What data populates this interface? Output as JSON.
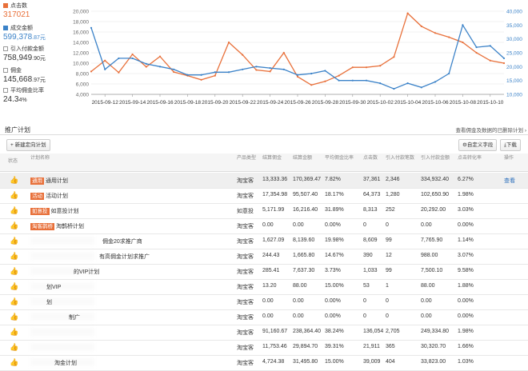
{
  "metrics": [
    {
      "label": "点击数",
      "value": "317021",
      "value_small": "",
      "checked": true,
      "color": "#e8703a"
    },
    {
      "label": "成交金额",
      "value": "599,378",
      "value_small": ".87元",
      "checked": true,
      "color": "#3b82c8"
    },
    {
      "label": "引入付款金额",
      "value": "758,949",
      "value_small": ".90元",
      "checked": false,
      "color": "#333333"
    },
    {
      "label": "佣金",
      "value": "145,668",
      "value_small": ".97元",
      "checked": false,
      "color": "#333333"
    },
    {
      "label": "平均佣金比率",
      "value": "24.3",
      "value_small": "4%",
      "checked": false,
      "color": "#333333"
    }
  ],
  "chart_data": {
    "type": "line",
    "x": [
      "2015-09-11",
      "2015-09-12",
      "2015-09-13",
      "2015-09-14",
      "2015-09-15",
      "2015-09-16",
      "2015-09-17",
      "2015-09-18",
      "2015-09-19",
      "2015-09-20",
      "2015-09-21",
      "2015-09-22",
      "2015-09-23",
      "2015-09-24",
      "2015-09-25",
      "2015-09-26",
      "2015-09-27",
      "2015-09-28",
      "2015-09-29",
      "2015-09-30",
      "2015-10-01",
      "2015-10-02",
      "2015-10-03",
      "2015-10-04",
      "2015-10-05",
      "2015-10-06",
      "2015-10-07",
      "2015-10-08",
      "2015-10-09",
      "2015-10-10",
      "2015-10-11"
    ],
    "xticks": [
      "2015-09-12",
      "2015-09-14",
      "2015-09-16",
      "2015-09-18",
      "2015-09-20",
      "2015-09-22",
      "2015-09-24",
      "2015-09-26",
      "2015-09-28",
      "2015-09-30",
      "2015-10-02",
      "2015-10-04",
      "2015-10-06",
      "2015-10-08",
      "2015-10-10"
    ],
    "yleft": {
      "min": 4000,
      "max": 20000,
      "ticks": [
        "4,000",
        "6,000",
        "8,000",
        "10,000",
        "12,000",
        "14,000",
        "16,000",
        "18,000",
        "20,000"
      ]
    },
    "yright": {
      "min": 10000,
      "max": 40000,
      "ticks": [
        "10,000",
        "15,000",
        "20,000",
        "25,000",
        "30,000",
        "35,000",
        "40,000"
      ]
    },
    "series": [
      {
        "axis": "left",
        "color": "#e8703a",
        "values": [
          8400,
          10500,
          8200,
          11700,
          9300,
          11300,
          8300,
          7600,
          6800,
          7600,
          14000,
          11600,
          8700,
          8400,
          12000,
          7400,
          5800,
          6500,
          7600,
          9200,
          9200,
          9500,
          11200,
          19600,
          17100,
          15800,
          15000,
          14000,
          12000,
          10500,
          10000
        ]
      },
      {
        "axis": "right",
        "color": "#3b82c8",
        "values": [
          34000,
          19000,
          23000,
          23000,
          21000,
          20000,
          19000,
          17000,
          17000,
          18000,
          18000,
          19000,
          20000,
          19500,
          19000,
          17000,
          17500,
          18500,
          15000,
          15000,
          15000,
          14000,
          12000,
          14000,
          12500,
          14500,
          17500,
          35000,
          27000,
          27500,
          23000
        ]
      }
    ]
  },
  "section": {
    "title": "推广计划",
    "link": "查看佣金及数据的已删除计划 ›"
  },
  "toolbar": {
    "new_plan": "+ 新建定向计划",
    "custom": "⚙自定义字段",
    "download": "⤓下载"
  },
  "columns": [
    "状态",
    "计划名称",
    "产品类型",
    "结算佣金",
    "结算金额",
    "平均佣金比率",
    "点击数",
    "引入付款笔数",
    "引入付款金额",
    "点击转化率",
    "操作"
  ],
  "rows": [
    {
      "tag": "通用",
      "name": "通用计划",
      "type": "淘宝客",
      "commission": "13,333.36",
      "amount": "170,369.47",
      "rate": "7.82%",
      "clicks": "37,361",
      "orders": "2,346",
      "pay": "334,932.40",
      "cvr": "6.27%",
      "op": "查看",
      "selected": true
    },
    {
      "tag": "活动",
      "name": "活动计划",
      "type": "淘宝客",
      "commission": "17,354.98",
      "amount": "95,507.40",
      "rate": "18.17%",
      "clicks": "64,373",
      "orders": "1,280",
      "pay": "102,650.90",
      "cvr": "1.98%",
      "op": "",
      "selected": false
    },
    {
      "tag": "如意投",
      "name": "如意投计划",
      "type": "如意投",
      "commission": "5,171.99",
      "amount": "16,216.40",
      "rate": "31.89%",
      "clicks": "8,313",
      "orders": "252",
      "pay": "20,292.00",
      "cvr": "3.03%",
      "op": "",
      "selected": false
    },
    {
      "tag": "淘客鹊桥",
      "name": "淘鹊桥计划",
      "type": "淘宝客",
      "commission": "0.00",
      "amount": "0.00",
      "rate": "0.00%",
      "clicks": "0",
      "orders": "0",
      "pay": "0.00",
      "cvr": "0.00%",
      "op": "",
      "selected": false
    },
    {
      "tag": "",
      "name": "佣金20求推广商",
      "type": "淘宝客",
      "commission": "1,627.09",
      "amount": "8,139.60",
      "rate": "19.98%",
      "clicks": "8,609",
      "orders": "99",
      "pay": "7,765.90",
      "cvr": "1.14%",
      "op": "",
      "selected": false
    },
    {
      "tag": "",
      "name": "有高佣金计划求推广",
      "type": "淘宝客",
      "commission": "244.43",
      "amount": "1,665.80",
      "rate": "14.67%",
      "clicks": "390",
      "orders": "12",
      "pay": "988.00",
      "cvr": "3.07%",
      "op": "",
      "selected": false
    },
    {
      "tag": "",
      "name": "的VIP计划",
      "type": "淘宝客",
      "commission": "285.41",
      "amount": "7,637.30",
      "rate": "3.73%",
      "clicks": "1,033",
      "orders": "99",
      "pay": "7,500.10",
      "cvr": "9.58%",
      "op": "",
      "selected": false
    },
    {
      "tag": "",
      "name": "划VIP",
      "type": "淘宝客",
      "commission": "13.20",
      "amount": "88.00",
      "rate": "15.00%",
      "clicks": "53",
      "orders": "1",
      "pay": "88.00",
      "cvr": "1.88%",
      "op": "",
      "selected": false
    },
    {
      "tag": "",
      "name": "划",
      "type": "淘宝客",
      "commission": "0.00",
      "amount": "0.00",
      "rate": "0.00%",
      "clicks": "0",
      "orders": "0",
      "pay": "0.00",
      "cvr": "0.00%",
      "op": "",
      "selected": false
    },
    {
      "tag": "",
      "name": "制广",
      "type": "淘宝客",
      "commission": "0.00",
      "amount": "0.00",
      "rate": "0.00%",
      "clicks": "0",
      "orders": "0",
      "pay": "0.00",
      "cvr": "0.00%",
      "op": "",
      "selected": false
    },
    {
      "tag": "",
      "name": "",
      "type": "淘宝客",
      "commission": "91,160.67",
      "amount": "238,364.40",
      "rate": "38.24%",
      "clicks": "136,054",
      "orders": "2,705",
      "pay": "249,334.80",
      "cvr": "1.98%",
      "op": "",
      "selected": false
    },
    {
      "tag": "",
      "name": "",
      "type": "淘宝客",
      "commission": "11,753.46",
      "amount": "29,894.70",
      "rate": "39.31%",
      "clicks": "21,911",
      "orders": "365",
      "pay": "30,320.70",
      "cvr": "1.66%",
      "op": "",
      "selected": false
    },
    {
      "tag": "",
      "name": "淘金计划",
      "type": "淘宝客",
      "commission": "4,724.38",
      "amount": "31,495.80",
      "rate": "15.00%",
      "clicks": "39,009",
      "orders": "404",
      "pay": "33,823.00",
      "cvr": "1.03%",
      "op": "",
      "selected": false
    }
  ]
}
